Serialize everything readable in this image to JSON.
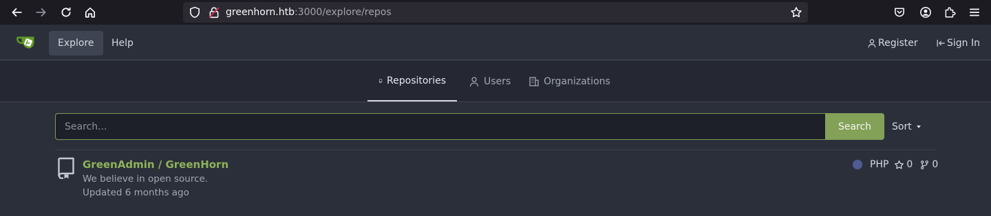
{
  "browser": {
    "url_host": "greenhorn.htb",
    "url_path": ":3000/explore/repos"
  },
  "header": {
    "nav": [
      {
        "label": "Explore",
        "active": true
      },
      {
        "label": "Help",
        "active": false
      }
    ],
    "register_label": "Register",
    "signin_label": "Sign In"
  },
  "tabs": [
    {
      "label": "Repositories",
      "icon": "repo-icon",
      "active": true
    },
    {
      "label": "Users",
      "icon": "person-icon",
      "active": false
    },
    {
      "label": "Organizations",
      "icon": "organization-icon",
      "active": false
    }
  ],
  "search": {
    "placeholder": "Search...",
    "button_label": "Search",
    "sort_label": "Sort"
  },
  "repos": [
    {
      "title": "GreenAdmin / GreenHorn",
      "description": "We believe in open source.",
      "updated": "Updated 6 months ago",
      "language": "PHP",
      "language_color": "#4f5d95",
      "stars": "0",
      "forks": "0"
    }
  ],
  "colors": {
    "accent": "#83a157",
    "link": "#8fb25a",
    "background": "#2b2f3a"
  }
}
